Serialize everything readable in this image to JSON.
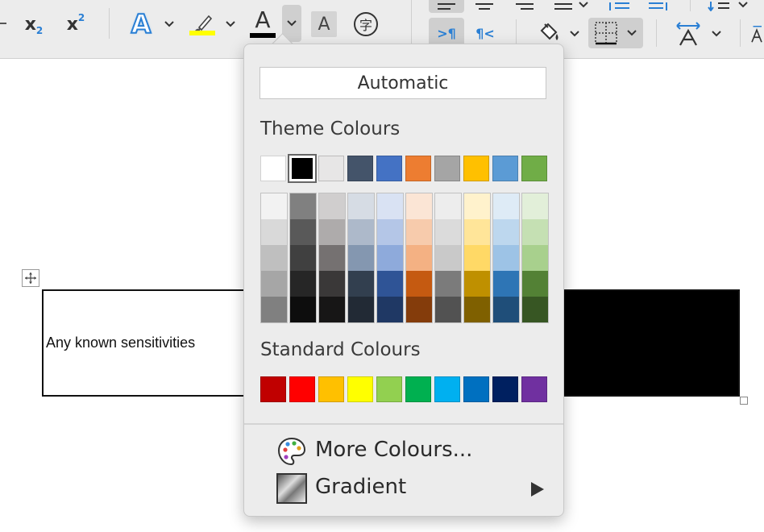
{
  "toolbar": {
    "subscript_label": "x",
    "subscript_sub": "2",
    "superscript_label": "x",
    "superscript_sup": "2",
    "text_effects_letter": "A",
    "font_color_letter": "A",
    "char_shading_letter": "A",
    "enclose_char": "字",
    "ltr_label": ">¶",
    "rtl_label": "¶<",
    "highlight_color": "#ffff00",
    "font_color_bar": "#000000"
  },
  "document": {
    "cell_text": "Any known sensitivities"
  },
  "color_popup": {
    "automatic_label": "Automatic",
    "theme_heading": "Theme Colours",
    "theme_colors": [
      "#ffffff",
      "#000000",
      "#e7e6e6",
      "#44546a",
      "#4472c4",
      "#ed7d31",
      "#a5a5a5",
      "#ffc000",
      "#5b9bd5",
      "#70ad47"
    ],
    "theme_shades": [
      [
        "#f2f2f2",
        "#d9d9d9",
        "#bfbfbf",
        "#a6a6a6",
        "#808080"
      ],
      [
        "#808080",
        "#595959",
        "#404040",
        "#262626",
        "#0d0d0d"
      ],
      [
        "#d0cece",
        "#aeabab",
        "#757171",
        "#3a3838",
        "#171616"
      ],
      [
        "#d6dce4",
        "#adb9ca",
        "#8497b0",
        "#323f4f",
        "#222a35"
      ],
      [
        "#d9e2f3",
        "#b4c6e7",
        "#8eaadb",
        "#2f5496",
        "#1f3864"
      ],
      [
        "#fbe5d5",
        "#f7cbac",
        "#f4b183",
        "#c55a11",
        "#843c0b"
      ],
      [
        "#ededed",
        "#dbdbdb",
        "#c9c9c9",
        "#7b7b7b",
        "#525252"
      ],
      [
        "#fff2cc",
        "#ffe599",
        "#ffd966",
        "#bf9000",
        "#7f6000"
      ],
      [
        "#deebf6",
        "#bdd7ee",
        "#9dc3e6",
        "#2e75b5",
        "#1f4e79"
      ],
      [
        "#e2efd9",
        "#c5e0b3",
        "#a8d08d",
        "#538135",
        "#375623"
      ]
    ],
    "standard_heading": "Standard Colours",
    "standard_colors": [
      "#c00000",
      "#ff0000",
      "#ffc000",
      "#ffff00",
      "#92d050",
      "#00b050",
      "#00b0f0",
      "#0070c0",
      "#002060",
      "#7030a0"
    ],
    "more_colours_label": "More Colours...",
    "gradient_label": "Gradient"
  }
}
